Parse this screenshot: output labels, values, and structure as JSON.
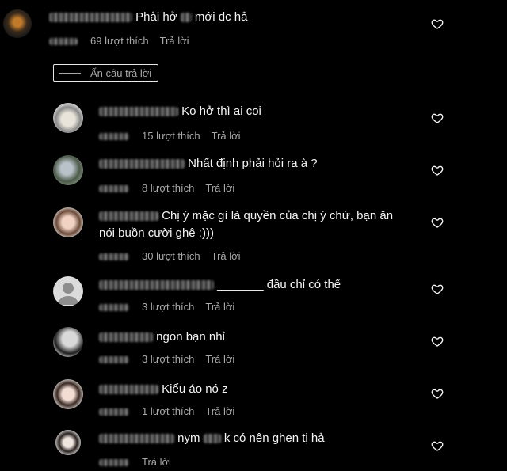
{
  "top_comment": {
    "text_before": "Phải hở",
    "text_after": "mới dc hả",
    "likes": "69 lượt thích",
    "reply": "Trả lời"
  },
  "hide_replies": "Ấn câu trả lời",
  "replies": [
    {
      "text": "Ko hở thì ai coi",
      "likes": "15 lượt thích",
      "reply": "Trả lời"
    },
    {
      "text": "Nhất định phải hỏi ra à ?",
      "likes": "8 lượt thích",
      "reply": "Trả lời"
    },
    {
      "text": "Chị ý mặc gì là quyền của chị ý chứ, bạn ăn",
      "text2": "nói buồn cười ghê :)))",
      "likes": "30 lượt thích",
      "reply": "Trả lời"
    },
    {
      "text": "_______ đầu chỉ có thế",
      "likes": "3 lượt thích",
      "reply": "Trả lời"
    },
    {
      "text": "ngon bạn nhỉ",
      "likes": "3 lượt thích",
      "reply": "Trả lời"
    },
    {
      "text": "Kiểu áo nó z",
      "likes": "1 lượt thích",
      "reply": "Trả lời"
    },
    {
      "text_before": "nym",
      "text_after": "k có nên ghen tị hả",
      "reply": "Trả lời"
    }
  ],
  "icons": {
    "heart": "heart-outline-icon"
  }
}
